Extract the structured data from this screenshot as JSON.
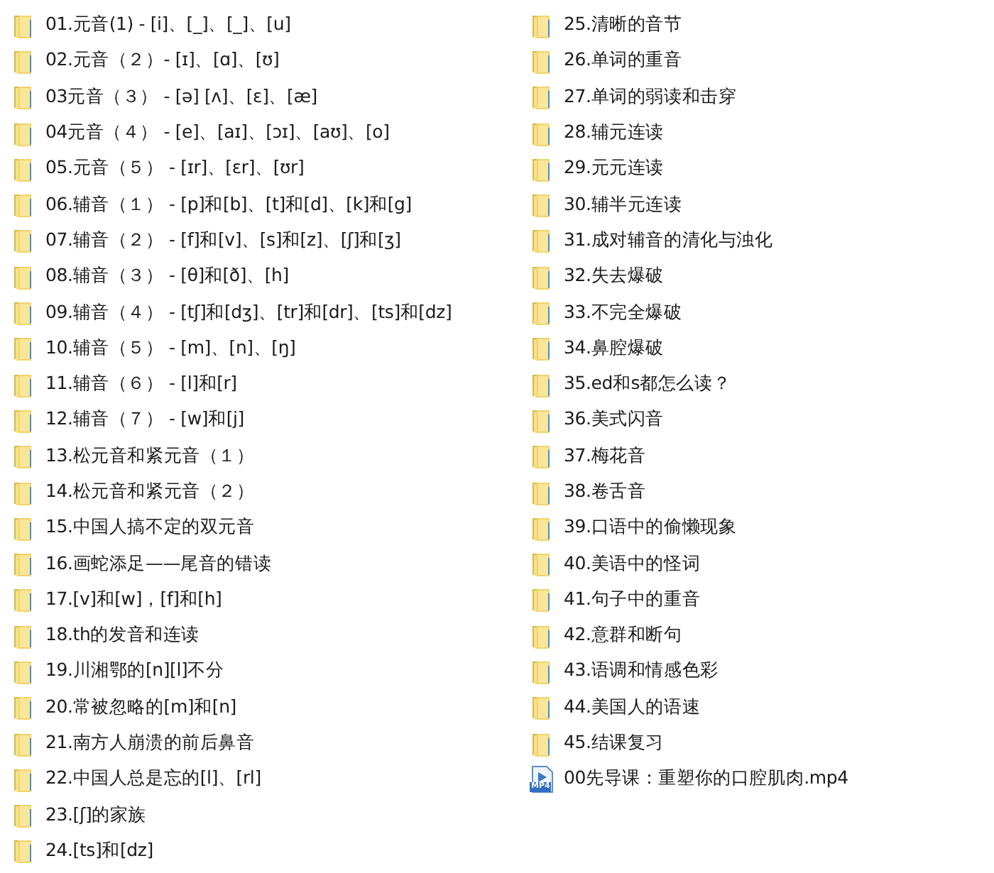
{
  "columns": [
    {
      "items": [
        {
          "kind": "folder",
          "name": "01.元音(1) - [i]、[_]、[_]、[u]"
        },
        {
          "kind": "folder",
          "name": "02.元音（２）- [ɪ]、[ɑ]、[ʊ]"
        },
        {
          "kind": "folder",
          "name": "03元音（３） - [ə] [ʌ]、[ɛ]、[æ]"
        },
        {
          "kind": "folder",
          "name": "04元音（４） - [e]、[aɪ]、[ɔɪ]、[aʊ]、[o]"
        },
        {
          "kind": "folder",
          "name": "05.元音（５） - [ɪr]、[ɛr]、[ʊr]"
        },
        {
          "kind": "folder",
          "name": "06.辅音（１） - [p]和[b]、[t]和[d]、[k]和[g]"
        },
        {
          "kind": "folder",
          "name": "07.辅音（２） - [f]和[v]、[s]和[z]、[ʃ]和[ʒ]"
        },
        {
          "kind": "folder",
          "name": "08.辅音（３） - [θ]和[ð]、[h]"
        },
        {
          "kind": "folder",
          "name": "09.辅音（４） - [tʃ]和[dʒ]、[tr]和[dr]、[ts]和[dz]"
        },
        {
          "kind": "folder",
          "name": "10.辅音（５） - [m]、[n]、[ŋ]"
        },
        {
          "kind": "folder",
          "name": "11.辅音（６） - [l]和[r]"
        },
        {
          "kind": "folder",
          "name": "12.辅音（７） - [w]和[j]"
        },
        {
          "kind": "folder",
          "name": "13.松元音和紧元音（１）"
        },
        {
          "kind": "folder",
          "name": "14.松元音和紧元音（２）"
        },
        {
          "kind": "folder",
          "name": "15.中国人搞不定的双元音"
        },
        {
          "kind": "folder",
          "name": "16.画蛇添足——尾音的错读"
        },
        {
          "kind": "folder",
          "name": "17.[v]和[w]，[f]和[h]"
        },
        {
          "kind": "folder",
          "name": "18.th的发音和连读"
        },
        {
          "kind": "folder",
          "name": "19.川湘鄂的[n][l]不分"
        },
        {
          "kind": "folder",
          "name": "20.常被忽略的[m]和[n]"
        },
        {
          "kind": "folder",
          "name": "21.南方人崩溃的前后鼻音"
        },
        {
          "kind": "folder",
          "name": "22.中国人总是忘的[l]、[rl]"
        },
        {
          "kind": "folder",
          "name": "23.[ʃ]的家族"
        },
        {
          "kind": "folder",
          "name": "24.[ts]和[dz]"
        }
      ]
    },
    {
      "items": [
        {
          "kind": "folder",
          "name": "25.清晰的音节"
        },
        {
          "kind": "folder",
          "name": "26.单词的重音"
        },
        {
          "kind": "folder",
          "name": "27.单词的弱读和击穿"
        },
        {
          "kind": "folder",
          "name": "28.辅元连读"
        },
        {
          "kind": "folder",
          "name": "29.元元连读"
        },
        {
          "kind": "folder",
          "name": "30.辅半元连读"
        },
        {
          "kind": "folder",
          "name": "31.成对辅音的清化与浊化"
        },
        {
          "kind": "folder",
          "name": "32.失去爆破"
        },
        {
          "kind": "folder",
          "name": "33.不完全爆破"
        },
        {
          "kind": "folder",
          "name": "34.鼻腔爆破"
        },
        {
          "kind": "folder",
          "name": "35.ed和s都怎么读？"
        },
        {
          "kind": "folder",
          "name": "36.美式闪音"
        },
        {
          "kind": "folder",
          "name": "37.梅花音"
        },
        {
          "kind": "folder",
          "name": "38.卷舌音"
        },
        {
          "kind": "folder",
          "name": "39.口语中的偷懒现象"
        },
        {
          "kind": "folder",
          "name": "40.美语中的怪词"
        },
        {
          "kind": "folder",
          "name": "41.句子中的重音"
        },
        {
          "kind": "folder",
          "name": "42.意群和断句"
        },
        {
          "kind": "folder",
          "name": "43.语调和情感色彩"
        },
        {
          "kind": "folder",
          "name": "44.美国人的语速"
        },
        {
          "kind": "folder",
          "name": "45.结课复习"
        },
        {
          "kind": "video",
          "name": "00先导课：重塑你的口腔肌肉.mp4",
          "badge": "MP4"
        }
      ]
    }
  ]
}
